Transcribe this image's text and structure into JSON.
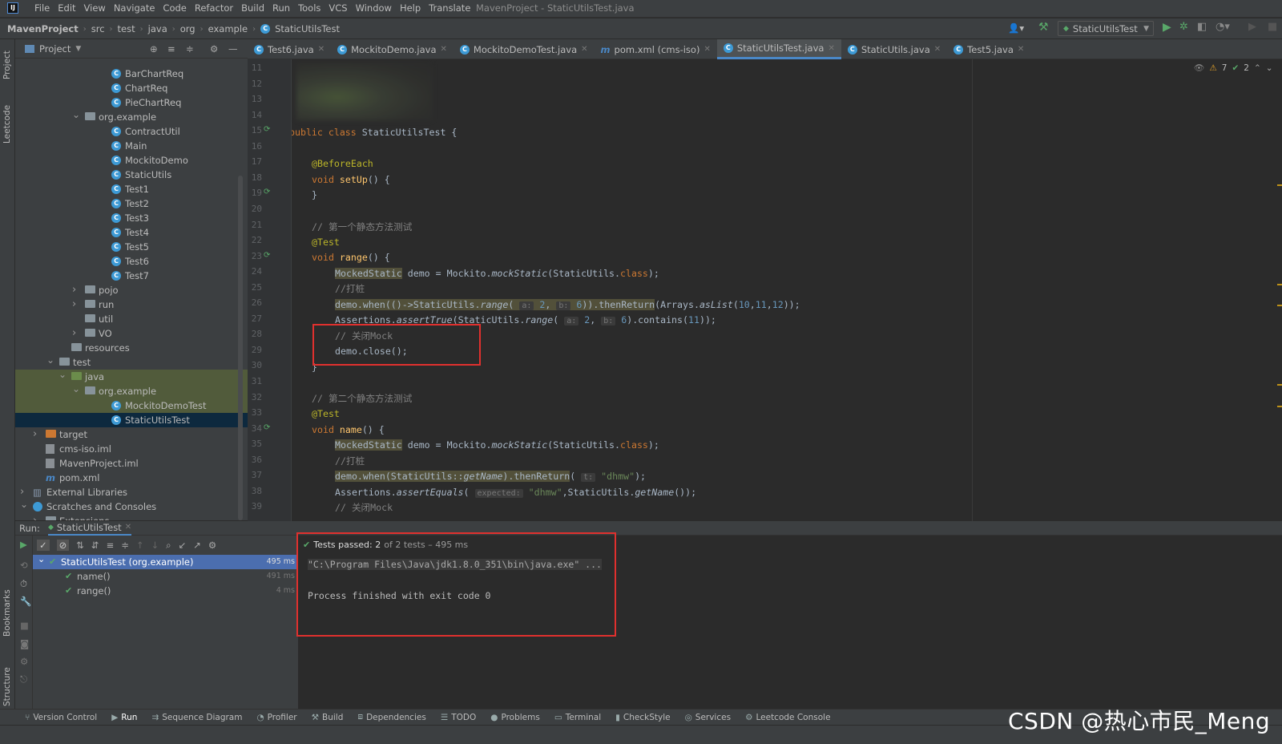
{
  "menubar": {
    "logo": "IJ",
    "items": [
      "File",
      "Edit",
      "View",
      "Navigate",
      "Code",
      "Refactor",
      "Build",
      "Run",
      "Tools",
      "VCS",
      "Window",
      "Help",
      "Translate"
    ],
    "title": "MavenProject - StaticUtilsTest.java"
  },
  "breadcrumb": [
    "MavenProject",
    "src",
    "test",
    "java",
    "org",
    "example",
    "StaticUtilsTest"
  ],
  "run_config": "StaticUtilsTest",
  "project_panel": {
    "label": "Project",
    "tree": [
      {
        "label": "BarChartReq",
        "indent": 120,
        "kind": "class"
      },
      {
        "label": "ChartReq",
        "indent": 120,
        "kind": "class"
      },
      {
        "label": "PieChartReq",
        "indent": 120,
        "kind": "class"
      },
      {
        "label": "org.example",
        "indent": 87,
        "kind": "package",
        "arrow": "open"
      },
      {
        "label": "ContractUtil",
        "indent": 120,
        "kind": "class"
      },
      {
        "label": "Main",
        "indent": 120,
        "kind": "class"
      },
      {
        "label": "MockitoDemo",
        "indent": 120,
        "kind": "class"
      },
      {
        "label": "StaticUtils",
        "indent": 120,
        "kind": "class"
      },
      {
        "label": "Test1",
        "indent": 120,
        "kind": "class"
      },
      {
        "label": "Test2",
        "indent": 120,
        "kind": "class"
      },
      {
        "label": "Test3",
        "indent": 120,
        "kind": "class"
      },
      {
        "label": "Test4",
        "indent": 120,
        "kind": "class"
      },
      {
        "label": "Test5",
        "indent": 120,
        "kind": "class"
      },
      {
        "label": "Test6",
        "indent": 120,
        "kind": "class"
      },
      {
        "label": "Test7",
        "indent": 120,
        "kind": "class"
      },
      {
        "label": "pojo",
        "indent": 87,
        "kind": "package",
        "arrow": "closed"
      },
      {
        "label": "run",
        "indent": 87,
        "kind": "package",
        "arrow": "closed"
      },
      {
        "label": "util",
        "indent": 87,
        "kind": "package"
      },
      {
        "label": "VO",
        "indent": 87,
        "kind": "package",
        "arrow": "closed"
      },
      {
        "label": "resources",
        "indent": 70,
        "kind": "folder"
      },
      {
        "label": "test",
        "indent": 55,
        "kind": "folder",
        "arrow": "open"
      },
      {
        "label": "java",
        "indent": 70,
        "kind": "folder-green",
        "arrow": "open",
        "highlight": true
      },
      {
        "label": "org.example",
        "indent": 87,
        "kind": "package",
        "arrow": "open",
        "highlight": true
      },
      {
        "label": "MockitoDemoTest",
        "indent": 120,
        "kind": "class",
        "highlight": true
      },
      {
        "label": "StaticUtilsTest",
        "indent": 120,
        "kind": "class",
        "selected": true
      },
      {
        "label": "target",
        "indent": 38,
        "kind": "folder-orange",
        "arrow": "closed"
      },
      {
        "label": "cms-iso.iml",
        "indent": 38,
        "kind": "file"
      },
      {
        "label": "MavenProject.iml",
        "indent": 38,
        "kind": "file"
      },
      {
        "label": "pom.xml",
        "indent": 38,
        "kind": "maven"
      },
      {
        "label": "External Libraries",
        "indent": 22,
        "kind": "lib",
        "arrow": "closed"
      },
      {
        "label": "Scratches and Consoles",
        "indent": 22,
        "kind": "scratch",
        "arrow": "open"
      },
      {
        "label": "Extensions",
        "indent": 38,
        "kind": "folder",
        "arrow": "closed"
      }
    ]
  },
  "editor_tabs": [
    {
      "label": "Test6.java",
      "icon": "class"
    },
    {
      "label": "MockitoDemo.java",
      "icon": "class"
    },
    {
      "label": "MockitoDemoTest.java",
      "icon": "class"
    },
    {
      "label": "pom.xml (cms-iso)",
      "icon": "maven"
    },
    {
      "label": "StaticUtilsTest.java",
      "icon": "class",
      "active": true
    },
    {
      "label": "StaticUtils.java",
      "icon": "class"
    },
    {
      "label": "Test5.java",
      "icon": "class"
    }
  ],
  "inspection": {
    "warnings": "7",
    "weak": "2"
  },
  "line_numbers": [
    "11",
    "12",
    "13",
    "14",
    "15",
    "16",
    "17",
    "18",
    "19",
    "20",
    "21",
    "22",
    "23",
    "24",
    "25",
    "26",
    "27",
    "28",
    "29",
    "30",
    "31",
    "32",
    "33",
    "34",
    "35",
    "36",
    "37",
    "38",
    "39"
  ],
  "code": {
    "l15_kw": "public class ",
    "l15_name": "StaticUtilsTest {",
    "l17": "@BeforeEach",
    "l18_kw": "void ",
    "l18_fn": "setUp",
    "l18_rest": "() {",
    "l19": "}",
    "l21": "// 第一个静态方法测试",
    "l22": "@Test",
    "l23_kw": "void ",
    "l23_fn": "range",
    "l23_rest": "() {",
    "l24_a": "MockedStatic",
    "l24_b": " demo = Mockito.",
    "l24_c": "mockStatic",
    "l24_d": "(StaticUtils.",
    "l24_e": "class",
    "l24_f": ");",
    "l25": "//打桩",
    "l26_a": "demo.when(()->StaticUtils.",
    "l26_b": "range",
    "l26_c": "( ",
    "l26_h1": "a:",
    "l26_n1": " 2",
    "l26_c2": ", ",
    "l26_h2": "b:",
    "l26_n2": " 6",
    "l26_d": ")).thenReturn",
    "l26_e": "(Arrays.",
    "l26_f": "asList",
    "l26_g": "(",
    "l26_n3": "10",
    "l26_g2": ",",
    "l26_n4": "11",
    "l26_g3": ",",
    "l26_n5": "12",
    "l26_g4": "));",
    "l27_a": "Assertions.",
    "l27_b": "assertTrue",
    "l27_c": "(StaticUtils.",
    "l27_d": "range",
    "l27_e": "( ",
    "l27_h1": "a:",
    "l27_n1": " 2",
    "l27_f": ", ",
    "l27_h2": "b:",
    "l27_n2": " 6",
    "l27_g": ").contains(",
    "l27_n3": "11",
    "l27_i": "));",
    "l28": "// 关闭Mock",
    "l29": "demo.close();",
    "l30": "}",
    "l32": "// 第二个静态方法测试",
    "l33": "@Test",
    "l34_kw": "void ",
    "l34_fn": "name",
    "l34_rest": "() {",
    "l35_a": "MockedStatic",
    "l35_b": " demo = Mockito.",
    "l35_c": "mockStatic",
    "l35_d": "(StaticUtils.",
    "l35_e": "class",
    "l35_f": ");",
    "l36": "//打桩",
    "l37_a": "demo.when(StaticUtils::",
    "l37_b": "getName",
    "l37_c": ").thenReturn",
    "l37_d": "( ",
    "l37_h": "t:",
    "l37_s": " \"dhmw\"",
    "l37_e": ");",
    "l38_a": "Assertions.",
    "l38_b": "assertEquals",
    "l38_c": "( ",
    "l38_h": "expected:",
    "l38_s": " \"dhmw\"",
    "l38_d": ",StaticUtils.",
    "l38_e": "getName",
    "l38_f": "());",
    "l39": "// 关闭Mock"
  },
  "run_panel": {
    "label": "Run:",
    "tab": "StaticUtilsTest",
    "tests": [
      {
        "name": "StaticUtilsTest (org.example)",
        "time": "495 ms"
      },
      {
        "name": "name()",
        "time": "491 ms"
      },
      {
        "name": "range()",
        "time": "4 ms"
      }
    ],
    "status_bold": "Tests passed: 2",
    "status_rest": " of 2 tests – 495 ms",
    "cmd": "\"C:\\Program Files\\Java\\jdk1.8.0_351\\bin\\java.exe\" ...",
    "exit": "Process finished with exit code 0"
  },
  "bottom_tools": [
    "Version Control",
    "Run",
    "Sequence Diagram",
    "Profiler",
    "Build",
    "Dependencies",
    "TODO",
    "Problems",
    "Terminal",
    "CheckStyle",
    "Services",
    "Leetcode Console"
  ],
  "side_labels": {
    "project": "Project",
    "leetcode": "Leetcode",
    "bookmarks": "Bookmarks",
    "structure": "Structure"
  },
  "watermark": "CSDN @热心市民_Meng"
}
